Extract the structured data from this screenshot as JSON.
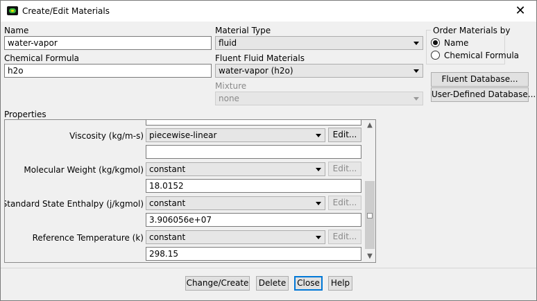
{
  "window": {
    "title": "Create/Edit Materials"
  },
  "name_field": {
    "label": "Name",
    "value": "water-vapor"
  },
  "formula_field": {
    "label": "Chemical Formula",
    "value": "h2o"
  },
  "material_type": {
    "label": "Material Type",
    "value": "fluid"
  },
  "fluent_materials": {
    "label": "Fluent Fluid Materials",
    "value": "water-vapor (h2o)"
  },
  "mixture": {
    "label": "Mixture",
    "value": "none"
  },
  "order_by": {
    "title": "Order Materials by",
    "options": [
      {
        "label": "Name",
        "selected": true
      },
      {
        "label": "Chemical Formula",
        "selected": false
      }
    ]
  },
  "side_buttons": {
    "fluent_db": "Fluent Database...",
    "user_db": "User-Defined Database..."
  },
  "properties": {
    "label": "Properties",
    "rows": [
      {
        "label": "Viscosity (kg/m-s)",
        "method": "piecewise-linear",
        "edit": "Edit...",
        "edit_enabled": true,
        "value": ""
      },
      {
        "label": "Molecular Weight (kg/kgmol)",
        "method": "constant",
        "edit": "Edit...",
        "edit_enabled": false,
        "value": "18.0152"
      },
      {
        "label": "Standard State Enthalpy (j/kgmol)",
        "method": "constant",
        "edit": "Edit...",
        "edit_enabled": false,
        "value": "3.906056e+07"
      },
      {
        "label": "Reference Temperature (k)",
        "method": "constant",
        "edit": "Edit...",
        "edit_enabled": false,
        "value": "298.15"
      }
    ]
  },
  "footer": {
    "change": "Change/Create",
    "delete": "Delete",
    "close": "Close",
    "help": "Help"
  },
  "icons": {
    "close": "close-icon",
    "app": "fluent-app-icon",
    "scroll_up": "chevron-up-icon",
    "scroll_down": "chevron-down-icon"
  }
}
